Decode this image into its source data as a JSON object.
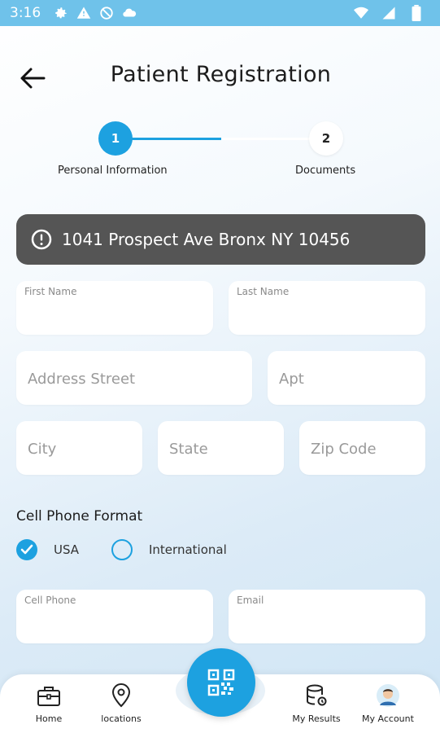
{
  "status_bar": {
    "time": "3:16"
  },
  "header": {
    "title": "Patient Registration"
  },
  "stepper": {
    "steps": [
      {
        "number": "1",
        "label": "Personal Information"
      },
      {
        "number": "2",
        "label": "Documents"
      }
    ]
  },
  "alert": {
    "text": "1041 Prospect Ave Bronx NY 10456"
  },
  "form": {
    "first_name_label": "First Name",
    "last_name_label": "Last Name",
    "address_placeholder": "Address Street",
    "apt_placeholder": "Apt",
    "city_placeholder": "City",
    "state_placeholder": "State",
    "zip_placeholder": "Zip Code",
    "phone_format_title": "Cell Phone Format",
    "phone_format_options": [
      "USA",
      "International"
    ],
    "phone_format_selected": "USA",
    "cell_phone_label": "Cell Phone",
    "email_label": "Email"
  },
  "nav": {
    "items": [
      {
        "label": "Home",
        "icon": "briefcase-icon"
      },
      {
        "label": "locations",
        "icon": "location-pin-icon"
      },
      {
        "label": "My Results",
        "icon": "database-icon"
      },
      {
        "label": "My Account",
        "icon": "avatar"
      }
    ],
    "center_icon": "qr-code-icon"
  },
  "colors": {
    "accent": "#1da1e0",
    "status_bar": "#6fc2ea",
    "alert_bg": "#555555"
  }
}
